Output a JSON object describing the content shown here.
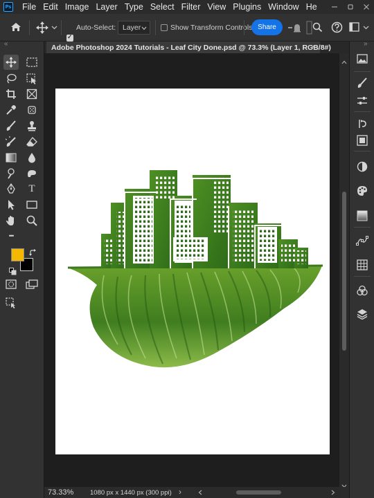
{
  "app": {
    "logo": "Ps",
    "menu": [
      "File",
      "Edit",
      "Image",
      "Layer",
      "Type",
      "Select",
      "Filter",
      "View",
      "Plugins",
      "Window",
      "He"
    ]
  },
  "window_controls": [
    "minimize-icon",
    "restore-icon",
    "close-icon"
  ],
  "options_bar": {
    "auto_select_label": "Auto-Select:",
    "auto_select_checked": true,
    "auto_select_target": "Layer",
    "show_transform_label": "Show Transform Controls",
    "show_transform_checked": false,
    "share_label": "Share"
  },
  "document": {
    "tab_title": "Adobe Photoshop 2024 Tutorials - Leaf City Done.psd @ 73.3% (Layer 1, RGB/8#)",
    "close_glyph": "×"
  },
  "tools": {
    "icons": [
      "move-tool-icon",
      "marquee-tool-icon",
      "lasso-tool-icon",
      "object-selection-tool-icon",
      "crop-tool-icon",
      "frame-tool-icon",
      "eyedropper-tool-icon",
      "spot-healing-tool-icon",
      "brush-tool-icon",
      "clone-stamp-tool-icon",
      "history-brush-tool-icon",
      "eraser-tool-icon",
      "gradient-tool-icon",
      "blur-tool-icon",
      "dodge-tool-icon",
      "pen-tool-icon",
      "type-tool-icon",
      "path-selection-tool-icon",
      "rectangle-tool-icon",
      "hand-tool-icon",
      "zoom-tool-icon",
      "more-tools-icon"
    ],
    "type_glyph": "T",
    "more_glyph": "•••",
    "foreground_color": "#f5b800",
    "background_color": "#000000"
  },
  "right_panel": {
    "icons": [
      "libraries-icon",
      "brushes-icon",
      "adjustments-icon",
      "history-icon",
      "swatches-icon",
      "channels-icon",
      "color-icon",
      "gradients-icon",
      "paths-icon",
      "properties-icon",
      "styles-icon",
      "layers-icon"
    ]
  },
  "status": {
    "zoom": "73.33%",
    "info": "1080 px x 1440 px (300 ppi)",
    "arrow_glyph": "›"
  },
  "colors": {
    "accent": "#1473e6",
    "leaf_dark": "#2f6b1c",
    "leaf_light": "#7fb23a"
  }
}
